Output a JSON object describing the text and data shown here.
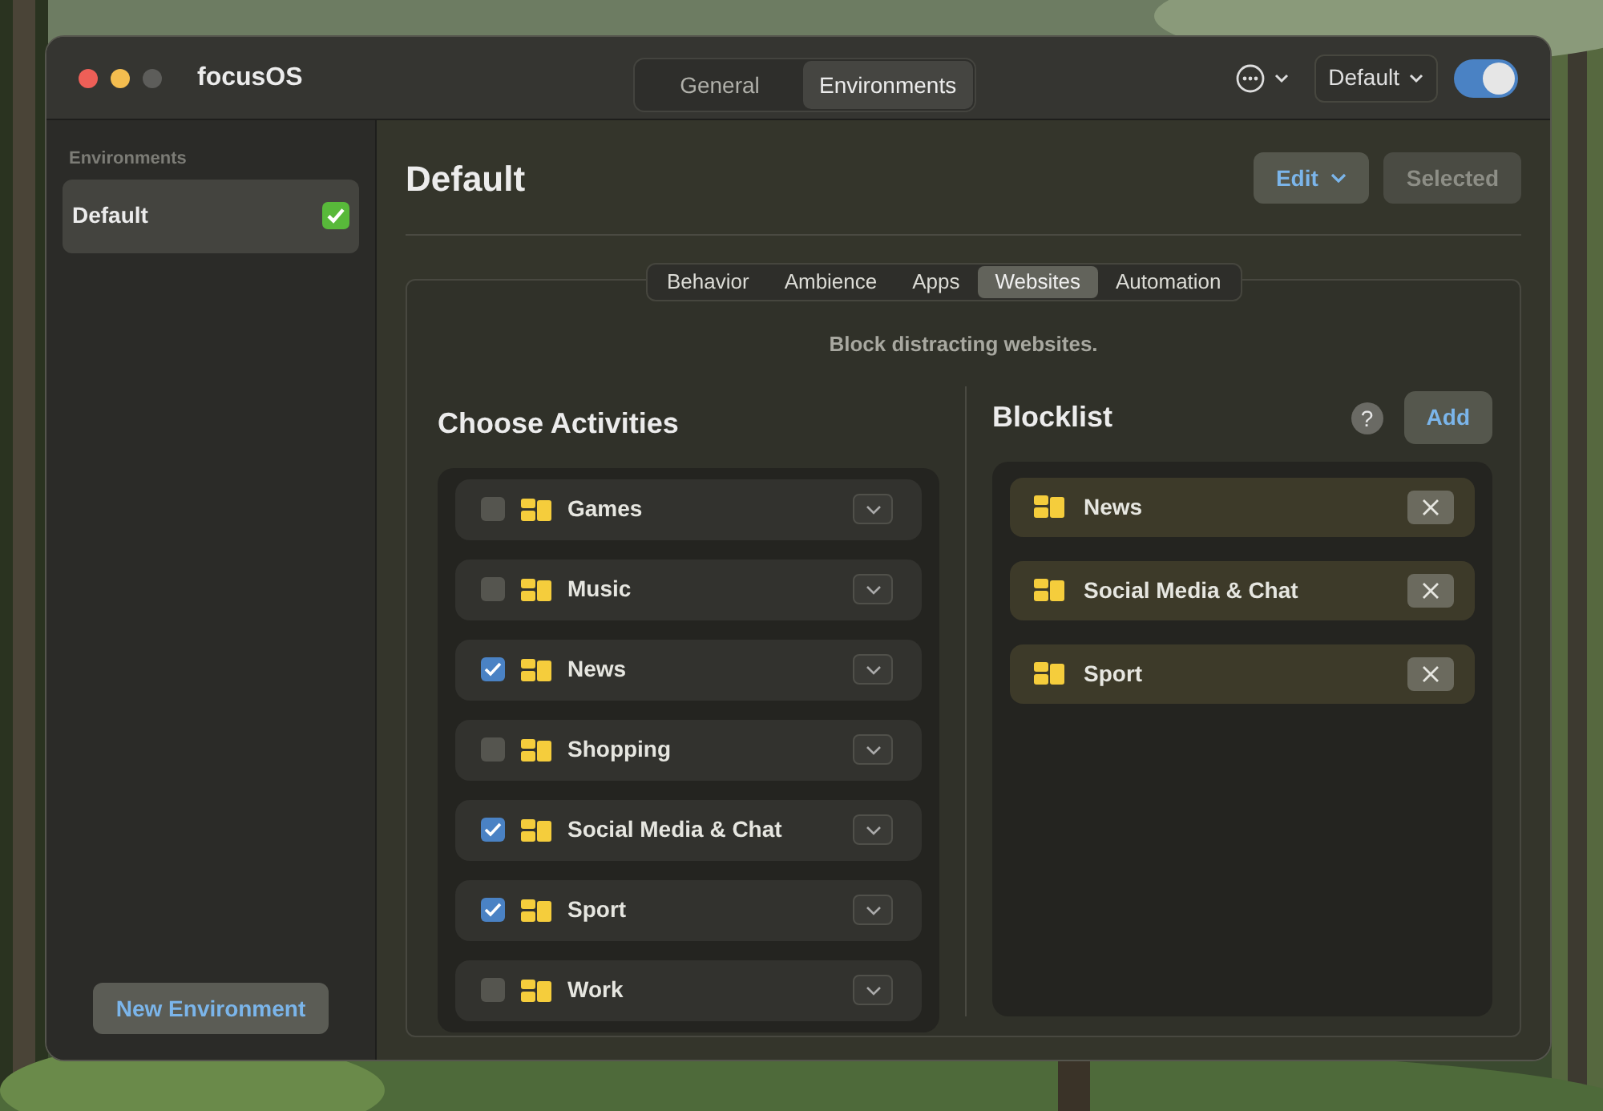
{
  "window": {
    "title": "focusOS"
  },
  "top_tabs": [
    {
      "label": "General",
      "selected": false
    },
    {
      "label": "Environments",
      "selected": true
    }
  ],
  "environment_menu": "Default",
  "enabled": {
    "on": true
  },
  "sidebar": {
    "heading": "Environments",
    "items": [
      {
        "label": "Default",
        "selected": true,
        "checked": true
      }
    ],
    "new_button": "New Environment"
  },
  "header": {
    "title": "Default",
    "edit_button": "Edit",
    "selected_button": "Selected"
  },
  "section_tabs": [
    {
      "label": "Behavior",
      "selected": false
    },
    {
      "label": "Ambience",
      "selected": false
    },
    {
      "label": "Apps",
      "selected": false
    },
    {
      "label": "Websites",
      "selected": true
    },
    {
      "label": "Automation",
      "selected": false
    }
  ],
  "description": "Block distracting websites.",
  "activities": {
    "title": "Choose Activities",
    "items": [
      {
        "name": "Games",
        "checked": false
      },
      {
        "name": "Music",
        "checked": false
      },
      {
        "name": "News",
        "checked": true
      },
      {
        "name": "Shopping",
        "checked": false
      },
      {
        "name": "Social Media & Chat",
        "checked": true
      },
      {
        "name": "Sport",
        "checked": true
      },
      {
        "name": "Work",
        "checked": false
      }
    ]
  },
  "blocklist": {
    "title": "Blocklist",
    "help": "?",
    "add_button": "Add",
    "items": [
      {
        "name": "News"
      },
      {
        "name": "Social Media & Chat"
      },
      {
        "name": "Sport"
      }
    ]
  }
}
